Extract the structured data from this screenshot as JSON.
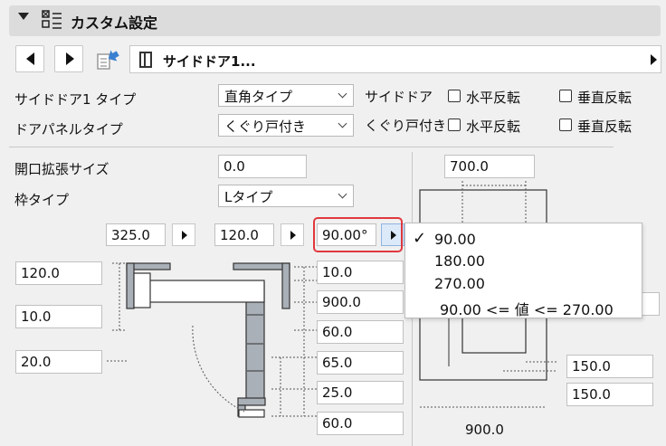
{
  "panel": {
    "title": "カスタム設定"
  },
  "nav": {
    "object_name": "サイドドア1..."
  },
  "settings": {
    "sidedoor_type_label": "サイドドア1 タイプ",
    "sidedoor_type_value": "直角タイプ",
    "door_panel_type_label": "ドアパネルタイプ",
    "door_panel_type_value": "くぐり戸付き",
    "group1_label": "サイドドア",
    "group2_label": "くぐり戸付き",
    "flip_h_label": "水平反転",
    "flip_v_label": "垂直反転",
    "opening_ext_label": "開口拡張サイズ",
    "opening_ext_value": "0.0",
    "frame_type_label": "枠タイプ",
    "frame_type_value": "Lタイプ"
  },
  "params": {
    "w1": "325.0",
    "w2": "120.0",
    "angle": "90.00°",
    "left1": "120.0",
    "left2": "10.0",
    "left3": "20.0",
    "r1": "10.0",
    "r2": "900.0",
    "r3": "60.0",
    "r4": "65.0",
    "r5": "25.0",
    "r6": "60.0",
    "top_right": "700.0",
    "br1": "150.0",
    "br2": "150.0",
    "bottom": "900.0"
  },
  "angle_menu": {
    "options": [
      "90.00",
      "180.00",
      "270.00"
    ],
    "selected": "90.00",
    "range_text": "90.00 <= 値 <= 270.00"
  }
}
